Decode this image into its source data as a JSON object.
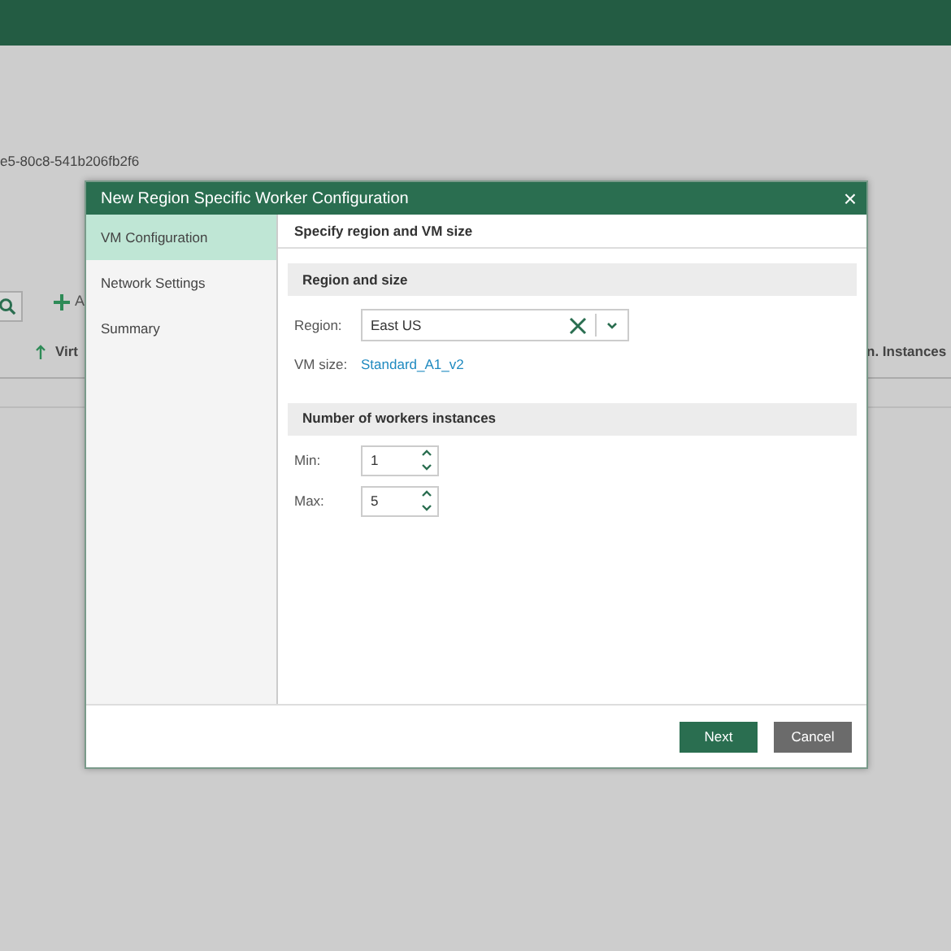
{
  "background": {
    "id_text": "e5-80c8-541b206fb2f6",
    "add_label": "A",
    "columns": [
      {
        "label": "Virt",
        "sorted": true
      },
      {
        "label": "n. Instances",
        "sorted": false
      }
    ]
  },
  "dialog": {
    "title": "New Region Specific Worker Configuration",
    "close": "×",
    "steps": [
      {
        "label": "VM Configuration",
        "selected": true
      },
      {
        "label": "Network Settings",
        "selected": false
      },
      {
        "label": "Summary",
        "selected": false
      }
    ],
    "heading": "Specify region and VM size",
    "sections": [
      {
        "title": "Region and size",
        "fields": [
          {
            "kind": "select",
            "label": "Region:",
            "value": "East US"
          },
          {
            "kind": "link",
            "label": "VM size:",
            "value": "Standard_A1_v2"
          }
        ]
      },
      {
        "title": "Number of workers instances",
        "fields": [
          {
            "kind": "spinner",
            "label": "Min:",
            "value": "1"
          },
          {
            "kind": "spinner",
            "label": "Max:",
            "value": "5"
          }
        ]
      }
    ],
    "buttons": [
      {
        "label": "Next",
        "kind": "primary"
      },
      {
        "label": "Cancel",
        "kind": "secondary"
      }
    ]
  }
}
